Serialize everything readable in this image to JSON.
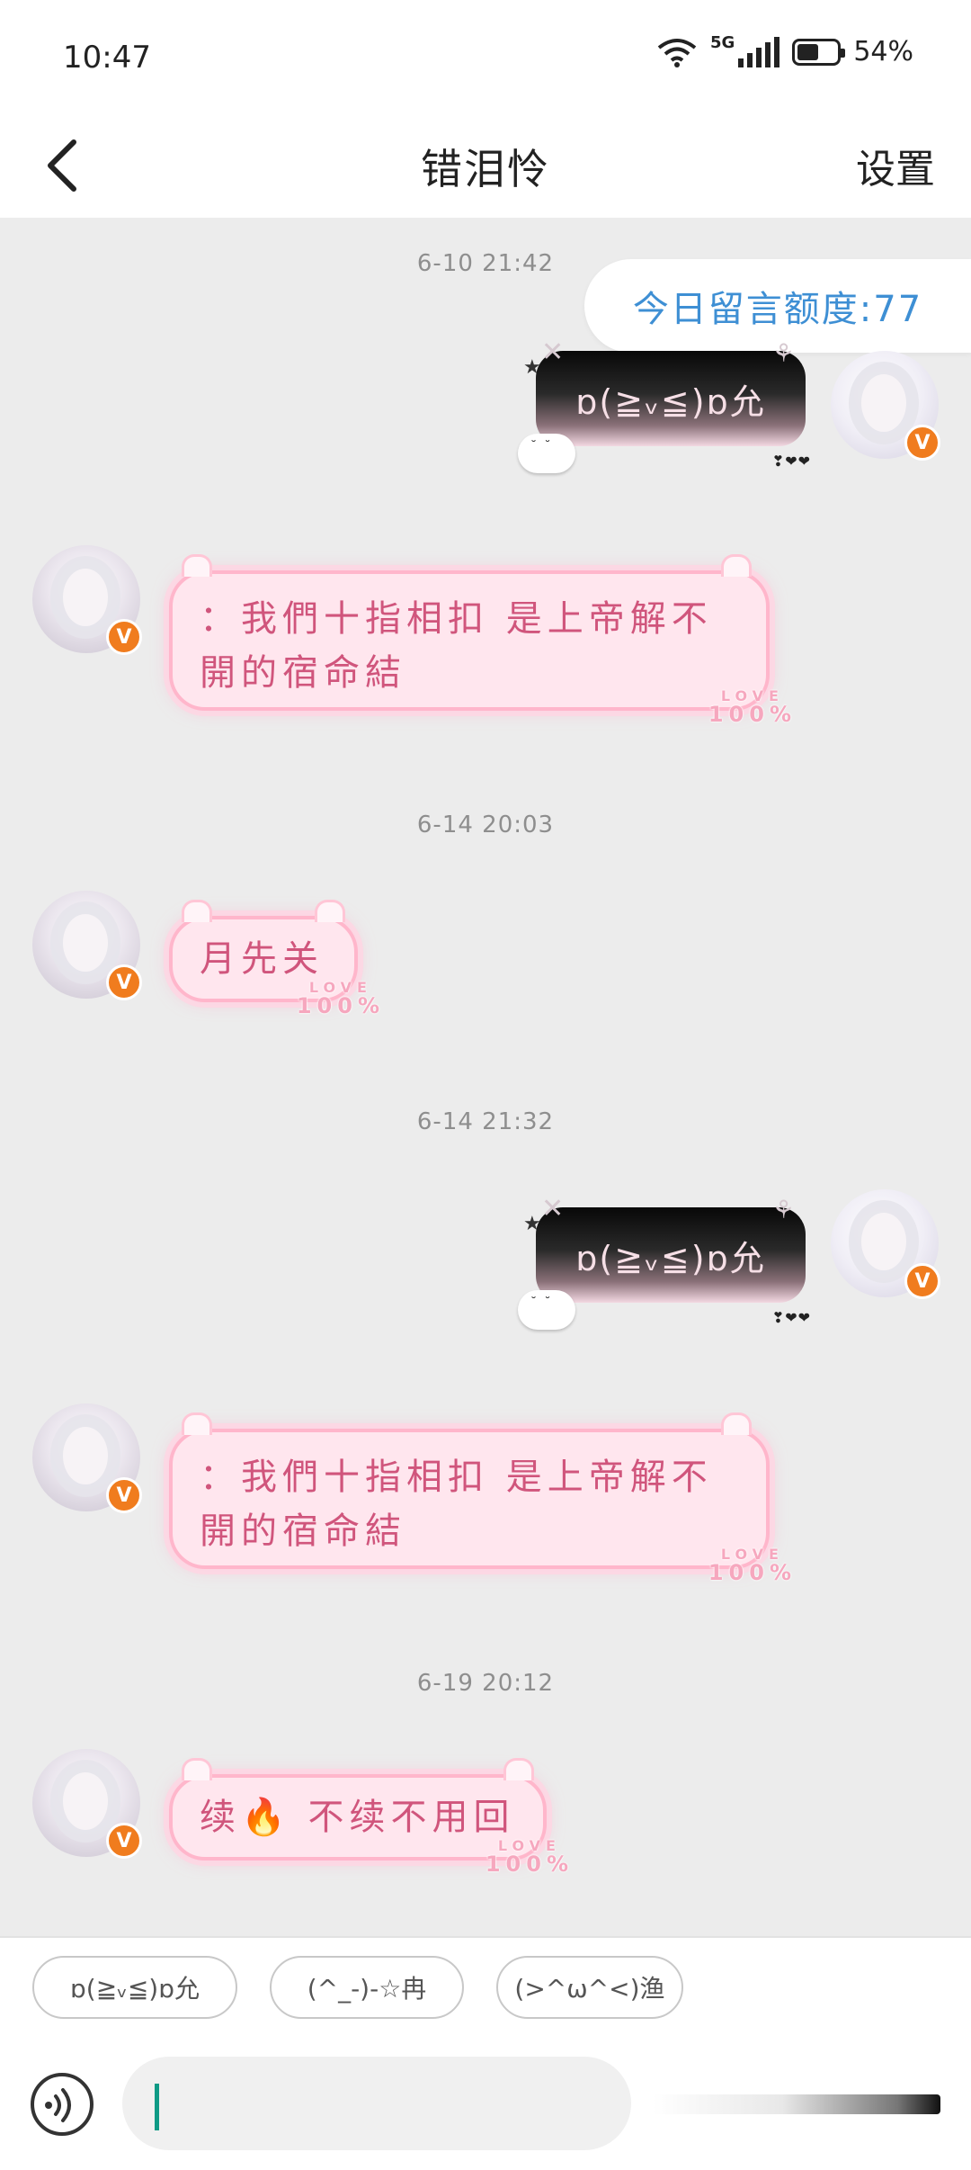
{
  "status_bar": {
    "time": "10:47",
    "network": "5G",
    "battery_percent_text": "54%",
    "battery_level": 0.54,
    "wifi_icon": "wifi-icon",
    "signal_icon": "cell-signal-icon"
  },
  "header": {
    "back_icon": "chevron-left-icon",
    "title": "错泪怜",
    "settings_label": "设置"
  },
  "chat": {
    "quota_label": "今日留言额度:77",
    "timestamps": [
      "6-10 21:42",
      "6-14 20:03",
      "6-14 21:32",
      "6-19 20:12"
    ],
    "messages": [
      {
        "side": "right",
        "style": "dark",
        "text": "ɒ(≧ᵥ≦)ɒ允"
      },
      {
        "side": "left",
        "style": "pink",
        "text_line1": "：我們十指相扣 是上帝解不",
        "text_line2": "開的宿命結"
      },
      {
        "side": "left",
        "style": "pink",
        "text": "月先关"
      },
      {
        "side": "right",
        "style": "dark",
        "text": "ɒ(≧ᵥ≦)ɒ允"
      },
      {
        "side": "left",
        "style": "pink",
        "text_line1": "：我們十指相扣 是上帝解不",
        "text_line2": "開的宿命結"
      },
      {
        "side": "left",
        "style": "pink",
        "text": "续🔥 不续不用回"
      }
    ],
    "bubble_badge": {
      "line1": "LOVE",
      "line2": "100%"
    },
    "verified_badge": "V"
  },
  "quick_replies": [
    "ɒ(≧ᵥ≦)ɒ允",
    "(^_-)-☆冉",
    "(>^ω^<)渔"
  ],
  "input": {
    "voice_icon": "voice-wave-icon",
    "placeholder": ""
  },
  "colors": {
    "chat_background": "#ececec",
    "quota_text": "#3e8fd4",
    "pink_text": "#d0557c",
    "badge_orange": "#f07c1e"
  }
}
